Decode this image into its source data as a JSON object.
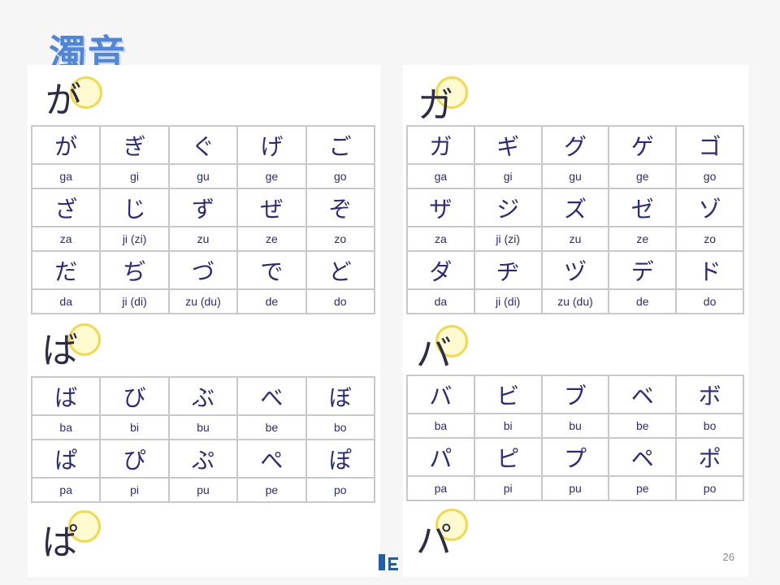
{
  "title": "濁音",
  "page_number": "26",
  "left": {
    "headers": [
      "が",
      "ば",
      "ぱ"
    ],
    "table1": [
      [
        "が",
        "ぎ",
        "ぐ",
        "げ",
        "ご"
      ],
      [
        "ga",
        "gi",
        "gu",
        "ge",
        "go"
      ],
      [
        "ざ",
        "じ",
        "ず",
        "ぜ",
        "ぞ"
      ],
      [
        "za",
        "ji (zi)",
        "zu",
        "ze",
        "zo"
      ],
      [
        "だ",
        "ぢ",
        "づ",
        "で",
        "ど"
      ],
      [
        "da",
        "ji (di)",
        "zu (du)",
        "de",
        "do"
      ]
    ],
    "table2": [
      [
        "ば",
        "び",
        "ぶ",
        "べ",
        "ぼ"
      ],
      [
        "ba",
        "bi",
        "bu",
        "be",
        "bo"
      ],
      [
        "ぱ",
        "ぴ",
        "ぷ",
        "ぺ",
        "ぽ"
      ],
      [
        "pa",
        "pi",
        "pu",
        "pe",
        "po"
      ]
    ]
  },
  "right": {
    "headers": [
      "ガ",
      "バ",
      "パ"
    ],
    "table1": [
      [
        "ガ",
        "ギ",
        "グ",
        "ゲ",
        "ゴ"
      ],
      [
        "ga",
        "gi",
        "gu",
        "ge",
        "go"
      ],
      [
        "ザ",
        "ジ",
        "ズ",
        "ゼ",
        "ゾ"
      ],
      [
        "za",
        "ji (zi)",
        "zu",
        "ze",
        "zo"
      ],
      [
        "ダ",
        "ヂ",
        "ヅ",
        "デ",
        "ド"
      ],
      [
        "da",
        "ji (di)",
        "zu (du)",
        "de",
        "do"
      ]
    ],
    "table2": [
      [
        "バ",
        "ビ",
        "ブ",
        "ベ",
        "ボ"
      ],
      [
        "ba",
        "bi",
        "bu",
        "be",
        "bo"
      ],
      [
        "パ",
        "ピ",
        "プ",
        "ペ",
        "ポ"
      ],
      [
        "pa",
        "pi",
        "pu",
        "pe",
        "po"
      ]
    ]
  },
  "colors": {
    "title": "#4f86d6",
    "kana": "#2b2b7a",
    "marker": "#f2d94a",
    "mark": "#d8332f"
  }
}
